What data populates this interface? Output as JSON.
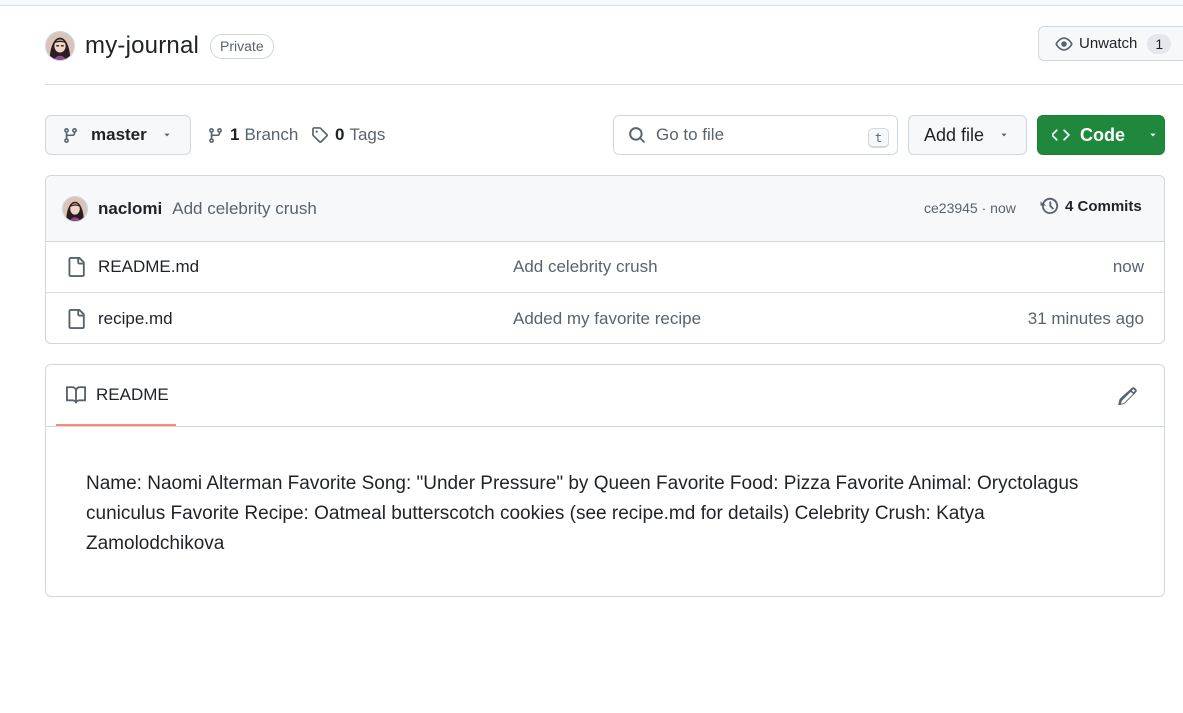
{
  "repo": {
    "name": "my-journal",
    "visibility": "Private"
  },
  "watch": {
    "label": "Unwatch",
    "count": "1"
  },
  "toolbar": {
    "branch": "master",
    "branch_count": "1",
    "branch_label": "Branch",
    "tag_count": "0",
    "tag_label": "Tags",
    "search_placeholder": "Go to file",
    "search_shortcut": "t",
    "add_file_label": "Add file",
    "code_label": "Code"
  },
  "latest_commit": {
    "author": "naclomi",
    "message": "Add celebrity crush",
    "meta": "ce23945 · now",
    "commits_label": "4 Commits"
  },
  "files": [
    {
      "name": "README.md",
      "message": "Add celebrity crush",
      "time": "now"
    },
    {
      "name": "recipe.md",
      "message": "Added my favorite recipe",
      "time": "31 minutes ago"
    }
  ],
  "readme": {
    "tab_label": "README",
    "body": "Name: Naomi Alterman Favorite Song: \"Under Pressure\" by Queen Favorite Food: Pizza Favorite Animal: Oryctolagus cuniculus Favorite Recipe: Oatmeal butterscotch cookies (see recipe.md for details) Celebrity Crush: Katya Zamolodchikova"
  },
  "colors": {
    "accent_green": "#1f883d",
    "tab_underline": "#fd8c73",
    "muted_text": "#59636e"
  }
}
